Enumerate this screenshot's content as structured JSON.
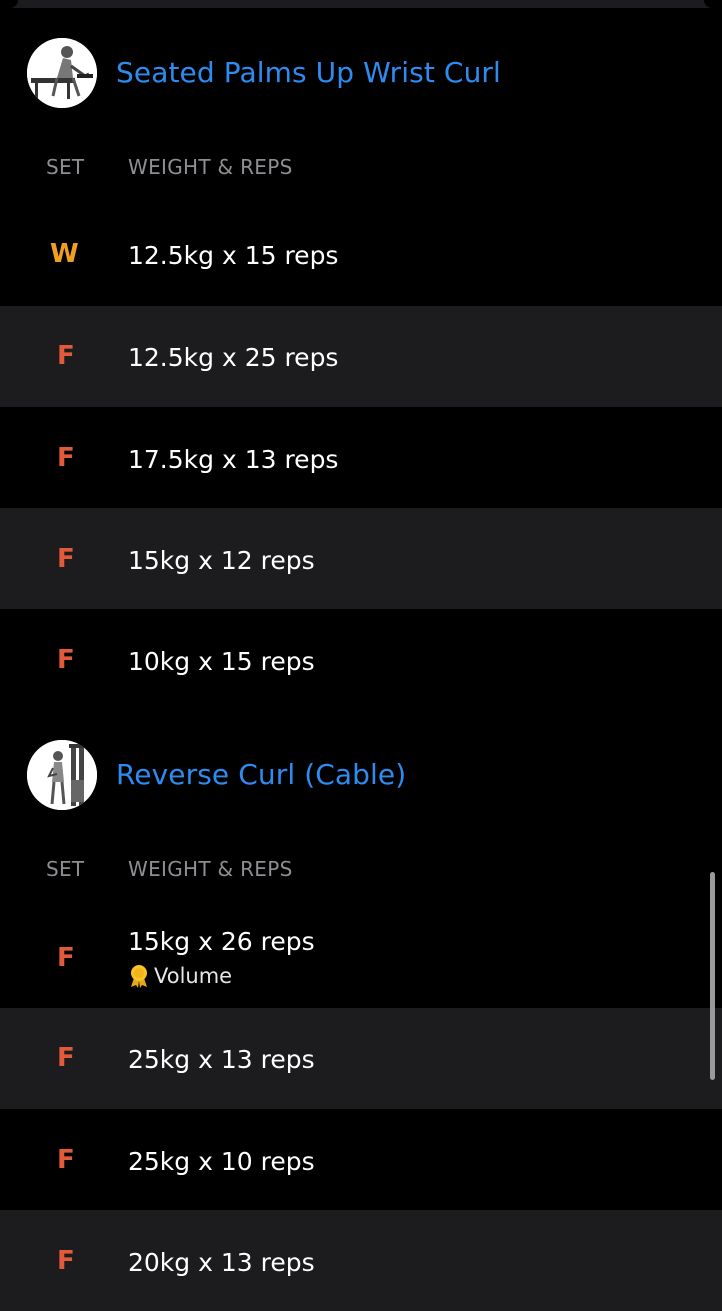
{
  "colors": {
    "accent": "#2e8bf0",
    "warmup": "#f0a01e",
    "failure": "#e35a3b",
    "alt_row": "#1c1c1e"
  },
  "exercises": [
    {
      "title": "Seated Palms Up Wrist Curl",
      "thumbnail": "seated-wrist-curl-illustration",
      "header": {
        "set": "SET",
        "weight_reps": "WEIGHT & REPS"
      },
      "sets": [
        {
          "type": "W",
          "value": "12.5kg x 15 reps"
        },
        {
          "type": "F",
          "value": "12.5kg x 25 reps"
        },
        {
          "type": "F",
          "value": "17.5kg x 13 reps"
        },
        {
          "type": "F",
          "value": "15kg x 12 reps"
        },
        {
          "type": "F",
          "value": "10kg x 15 reps"
        }
      ]
    },
    {
      "title": "Reverse Curl (Cable)",
      "thumbnail": "cable-reverse-curl-illustration",
      "header": {
        "set": "SET",
        "weight_reps": "WEIGHT & REPS"
      },
      "sets": [
        {
          "type": "F",
          "value": "15kg x 26 reps",
          "badge": "Volume",
          "badge_icon": "medal-icon"
        },
        {
          "type": "F",
          "value": "25kg x 13 reps"
        },
        {
          "type": "F",
          "value": "25kg x 10 reps"
        },
        {
          "type": "F",
          "value": "20kg x 13 reps"
        }
      ]
    }
  ]
}
